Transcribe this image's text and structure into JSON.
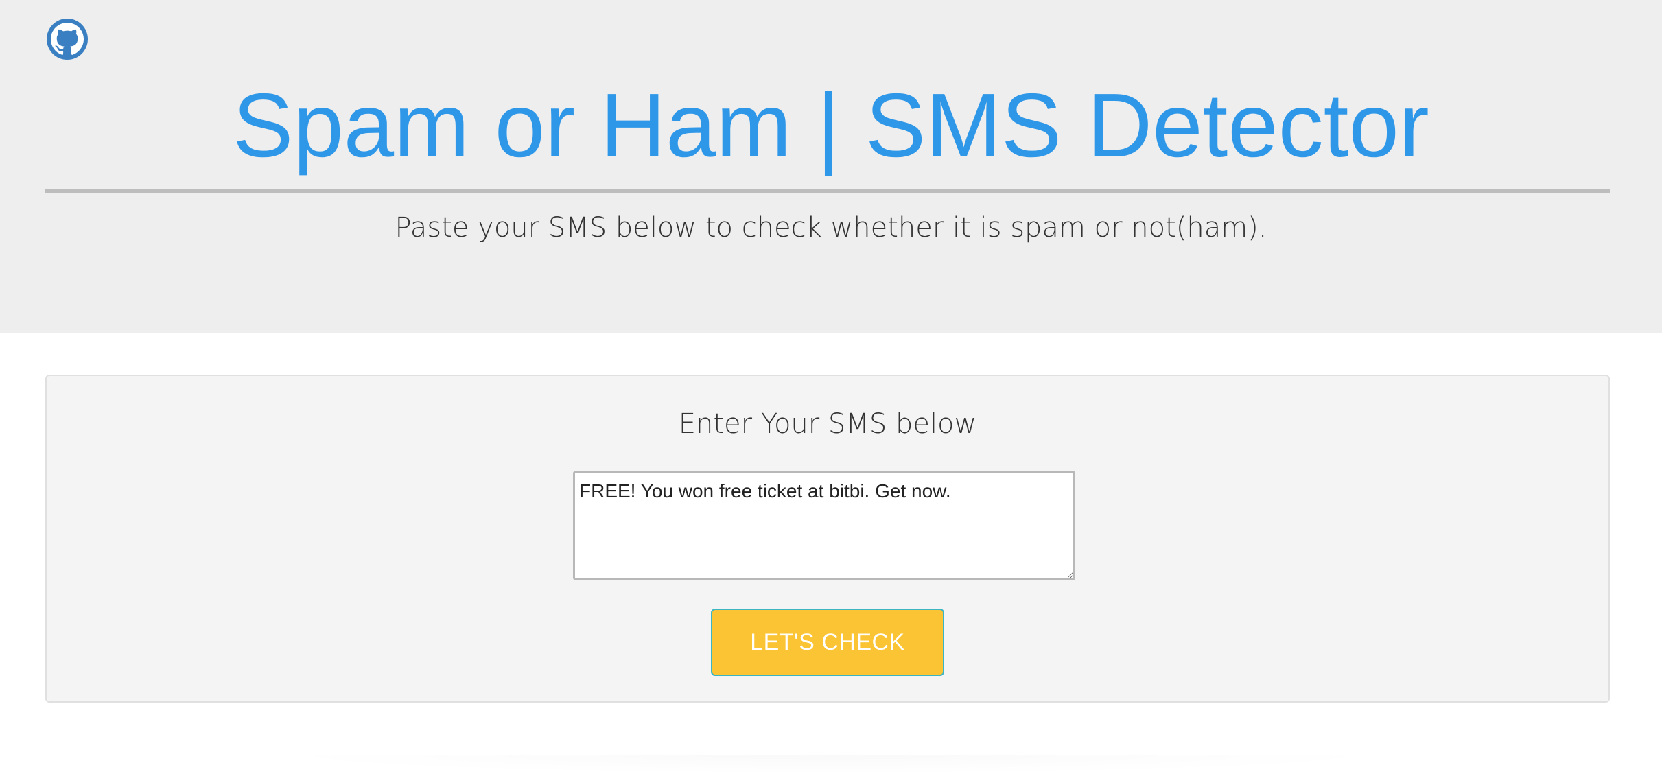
{
  "header": {
    "github_icon": "github-icon",
    "title": "Spam or Ham | SMS Detector",
    "subtitle": "Paste your SMS below to check whether it is spam or not(ham).",
    "title_color": "#2f97e8",
    "background_color": "#eeeeee"
  },
  "form": {
    "heading": "Enter Your SMS below",
    "sms_value": "FREE! You won free ticket at bitbi. Get now. ",
    "submit_label": "LET'S CHECK",
    "button_color": "#fbc434",
    "button_border_color": "#39b5c4"
  }
}
